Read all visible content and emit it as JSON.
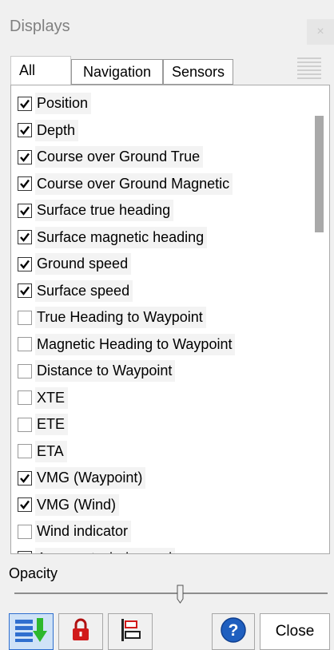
{
  "window": {
    "title": "Displays",
    "close_glyph": "×"
  },
  "tabs": [
    {
      "label": "All",
      "active": true
    },
    {
      "label": "Navigation",
      "active": false
    },
    {
      "label": "Sensors",
      "active": false
    }
  ],
  "list_items": [
    {
      "label": "Position",
      "checked": true
    },
    {
      "label": "Depth",
      "checked": true
    },
    {
      "label": "Course over Ground True",
      "checked": true
    },
    {
      "label": "Course over Ground Magnetic",
      "checked": true
    },
    {
      "label": "Surface true heading",
      "checked": true
    },
    {
      "label": "Surface magnetic heading",
      "checked": true
    },
    {
      "label": "Ground speed",
      "checked": true
    },
    {
      "label": "Surface speed",
      "checked": true
    },
    {
      "label": "True Heading to Waypoint",
      "checked": false
    },
    {
      "label": "Magnetic Heading to Waypoint",
      "checked": false
    },
    {
      "label": "Distance to Waypoint",
      "checked": false
    },
    {
      "label": "XTE",
      "checked": false
    },
    {
      "label": "ETE",
      "checked": false
    },
    {
      "label": "ETA",
      "checked": false
    },
    {
      "label": "VMG (Waypoint)",
      "checked": true
    },
    {
      "label": "VMG (Wind)",
      "checked": true
    },
    {
      "label": "Wind indicator",
      "checked": false
    },
    {
      "label": "Apparent wind speed",
      "checked": true
    }
  ],
  "opacity": {
    "label": "Opacity",
    "value_fraction": 0.53
  },
  "toolbar": {
    "icons": [
      "download-list-icon",
      "lock-icon",
      "align-left-icon",
      "help-icon"
    ],
    "close_label": "Close"
  },
  "colors": {
    "accent": "#2f6fcf",
    "icon_green": "#2db82d",
    "lock_red": "#d11a1a"
  }
}
